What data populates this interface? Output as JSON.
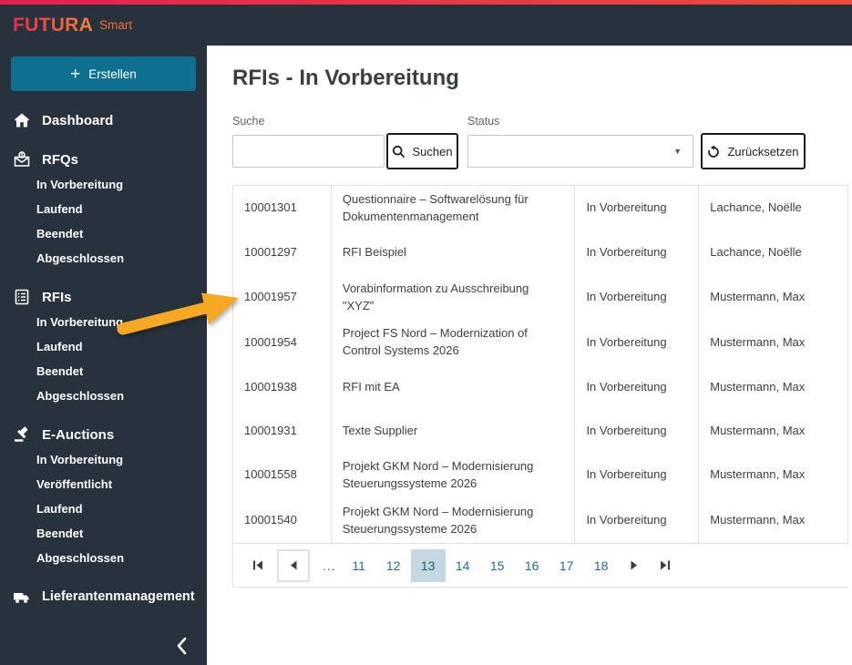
{
  "header": {
    "brand": "FUTURA",
    "brand_suffix": "Smart"
  },
  "sidebar": {
    "create_label": "Erstellen",
    "sections": [
      {
        "label": "Dashboard",
        "icon": "home-icon",
        "children": []
      },
      {
        "label": "RFQs",
        "icon": "rfq-envelope-icon",
        "children": [
          "In Vorbereitung",
          "Laufend",
          "Beendet",
          "Abgeschlossen"
        ]
      },
      {
        "label": "RFIs",
        "icon": "rfi-list-icon",
        "children": [
          "In Vorbereitung",
          "Laufend",
          "Beendet",
          "Abgeschlossen"
        ]
      },
      {
        "label": "E-Auctions",
        "icon": "gavel-icon",
        "children": [
          "In Vorbereitung",
          "Veröffentlicht",
          "Laufend",
          "Beendet",
          "Abgeschlossen"
        ]
      },
      {
        "label": "Lieferantenmanagement",
        "icon": "truck-icon",
        "children": []
      }
    ],
    "collapse_icon": "chevron-left-icon"
  },
  "main": {
    "title": "RFIs -  In Vorbereitung",
    "filters": {
      "search_label": "Suche",
      "search_value": "",
      "search_button": "Suchen",
      "status_label": "Status",
      "status_value": "",
      "reset_button": "Zurücksetzen"
    },
    "table": {
      "rows": [
        {
          "id": "10001301",
          "title": "Questionnaire – Softwarelösung für Dokumentenmanagement",
          "status": "In Vorbereitung",
          "owner": "Lachance, Noëlle"
        },
        {
          "id": "10001297",
          "title": "RFI Beispiel",
          "status": "In Vorbereitung",
          "owner": "Lachance, Noëlle"
        },
        {
          "id": "10001957",
          "title": "Vorabinformation zu Ausschreibung \"XYZ\"",
          "status": "In Vorbereitung",
          "owner": "Mustermann, Max"
        },
        {
          "id": "10001954",
          "title": "Project FS Nord – Modernization of Control Systems 2026",
          "status": "In Vorbereitung",
          "owner": "Mustermann, Max"
        },
        {
          "id": "10001938",
          "title": "RFI mit EA",
          "status": "In Vorbereitung",
          "owner": "Mustermann, Max"
        },
        {
          "id": "10001931",
          "title": "Texte Supplier",
          "status": "In Vorbereitung",
          "owner": "Mustermann, Max"
        },
        {
          "id": "10001558",
          "title": "Projekt GKM Nord – Modernisierung Steuerungssysteme 2026",
          "status": "In Vorbereitung",
          "owner": "Mustermann, Max"
        },
        {
          "id": "10001540",
          "title": "Projekt GKM Nord – Modernisierung Steuerungssysteme 2026",
          "status": "In Vorbereitung",
          "owner": "Mustermann, Max"
        }
      ]
    },
    "pagination": {
      "ellipsis": "...",
      "pages": [
        "11",
        "12",
        "13",
        "14",
        "15",
        "16",
        "17",
        "18"
      ],
      "current": "13"
    }
  },
  "colors": {
    "accent_bar_left": "#e61e4f",
    "accent_bar_right": "#f04a38",
    "sidebar_bg": "#28323c",
    "create_button_bg": "#0f6f8e",
    "pagination_link": "#1d6d8e",
    "pagination_active_bg": "#c3d8e0",
    "annotation_arrow": "#f7a823"
  }
}
